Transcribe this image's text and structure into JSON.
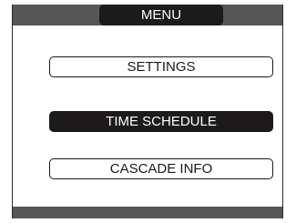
{
  "header": {
    "title": "MENU"
  },
  "menu": {
    "items": [
      {
        "label": "SETTINGS",
        "selected": false
      },
      {
        "label": "TIME SCHEDULE",
        "selected": true
      },
      {
        "label": "CASCADE INFO",
        "selected": false
      }
    ]
  },
  "colors": {
    "bar": "#565656",
    "highlight": "#1c1a1b",
    "background": "#ffffff",
    "text_on_highlight": "#ffffff"
  }
}
